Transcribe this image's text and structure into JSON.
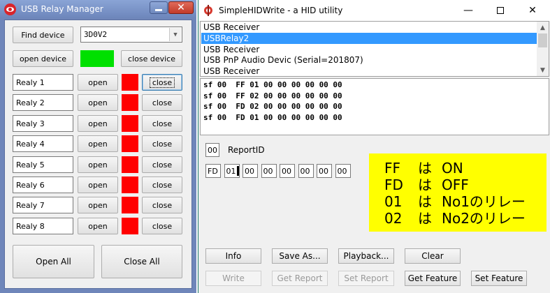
{
  "relay_manager": {
    "title": "USB Relay Manager",
    "find_device_label": "Find device",
    "device_serial": "3D0V2",
    "open_device_label": "open device",
    "close_device_label": "close device",
    "device_status_color": "#00e000",
    "relays": [
      {
        "name": "Realy 1",
        "open_label": "open",
        "close_label": "close",
        "state_color": "#ff0000"
      },
      {
        "name": "Realy 2",
        "open_label": "open",
        "close_label": "close",
        "state_color": "#ff0000"
      },
      {
        "name": "Realy 3",
        "open_label": "open",
        "close_label": "close",
        "state_color": "#ff0000"
      },
      {
        "name": "Realy 4",
        "open_label": "open",
        "close_label": "close",
        "state_color": "#ff0000"
      },
      {
        "name": "Realy 5",
        "open_label": "open",
        "close_label": "close",
        "state_color": "#ff0000"
      },
      {
        "name": "Realy 6",
        "open_label": "open",
        "close_label": "close",
        "state_color": "#ff0000"
      },
      {
        "name": "Realy 7",
        "open_label": "open",
        "close_label": "close",
        "state_color": "#ff0000"
      },
      {
        "name": "Realy 8",
        "open_label": "open",
        "close_label": "close",
        "state_color": "#ff0000"
      }
    ],
    "open_all_label": "Open All",
    "close_all_label": "Close All"
  },
  "hid_write": {
    "title": "SimpleHIDWrite - a HID utility",
    "devices": [
      {
        "label": "USB Receiver",
        "selected": false
      },
      {
        "label": "USBRelay2",
        "selected": true
      },
      {
        "label": "USB Receiver",
        "selected": false
      },
      {
        "label": "USB PnP Audio Devic (Serial=201807)",
        "selected": false
      },
      {
        "label": "USB Receiver",
        "selected": false
      }
    ],
    "log_lines": [
      "sf 00  FF 01 00 00 00 00 00 00",
      "sf 00  FF 02 00 00 00 00 00 00",
      "sf 00  FD 02 00 00 00 00 00 00",
      "sf 00  FD 01 00 00 00 00 00 00"
    ],
    "report_id_value": "00",
    "report_id_label": "ReportID",
    "report_bytes": [
      "FD",
      "01",
      "00",
      "00",
      "00",
      "00",
      "00",
      "00"
    ],
    "note": [
      {
        "code": "FF",
        "particle": "は",
        "meaning": "ON"
      },
      {
        "code": "FD",
        "particle": "は",
        "meaning": "OFF"
      },
      {
        "code": "01",
        "particle": "は",
        "meaning": "No1のリレー"
      },
      {
        "code": "02",
        "particle": "は",
        "meaning": "No2のリレー"
      }
    ],
    "note_color": "#ffff00",
    "buttons_row1": {
      "info": "Info",
      "save_as": "Save As...",
      "playback": "Playback...",
      "clear": "Clear"
    },
    "buttons_row2": {
      "write": "Write",
      "get_report": "Get Report",
      "set_report": "Set Report",
      "get_feature": "Get Feature",
      "set_feature": "Set Feature"
    }
  }
}
